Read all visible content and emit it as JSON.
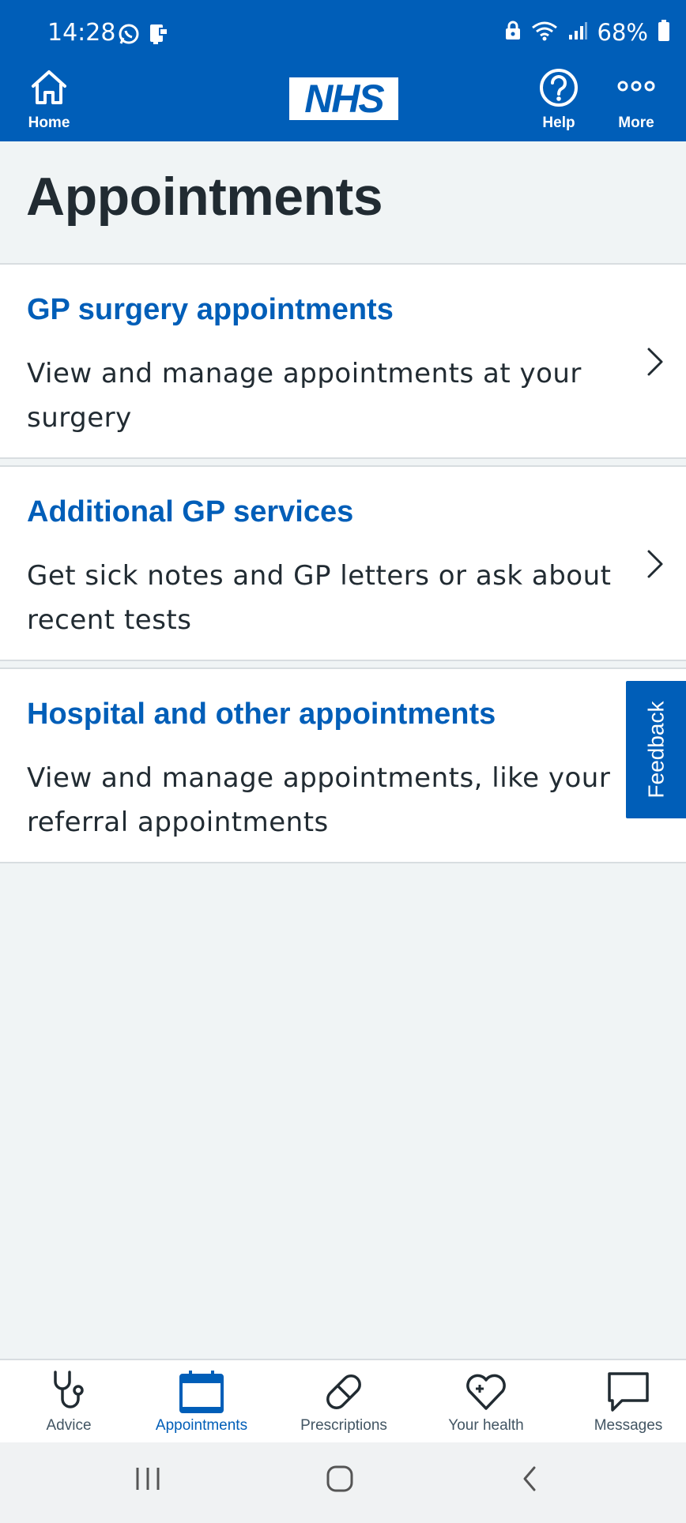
{
  "status_bar": {
    "time": "14:28",
    "battery": "68%",
    "icons_left": [
      "whatsapp-icon",
      "notification-app-icon"
    ],
    "icons_right": [
      "lock-icon",
      "wifi-icon",
      "signal-icon",
      "battery-icon"
    ]
  },
  "app_bar": {
    "home_label": "Home",
    "logo_text": "NHS",
    "help_label": "Help",
    "more_label": "More"
  },
  "page": {
    "title": "Appointments"
  },
  "cards": [
    {
      "title": "GP surgery appointments",
      "description": "View and manage appointments at your surgery"
    },
    {
      "title": "Additional GP services",
      "description": "Get sick notes and GP letters or ask about recent tests"
    },
    {
      "title": "Hospital and other appointments",
      "description": "View and manage appointments, like your referral appointments"
    }
  ],
  "feedback": {
    "label": "Feedback"
  },
  "bottom_nav": {
    "items": [
      {
        "label": "Advice",
        "icon": "stethoscope-icon",
        "active": false
      },
      {
        "label": "Appointments",
        "icon": "calendar-icon",
        "active": true
      },
      {
        "label": "Prescriptions",
        "icon": "pill-icon",
        "active": false
      },
      {
        "label": "Your health",
        "icon": "heart-plus-icon",
        "active": false
      },
      {
        "label": "Messages",
        "icon": "speech-bubble-icon",
        "active": false
      }
    ]
  },
  "colors": {
    "nhs_blue": "#005eb8",
    "text_dark": "#212b32",
    "background": "#f0f4f5",
    "border": "#d8dde0"
  }
}
